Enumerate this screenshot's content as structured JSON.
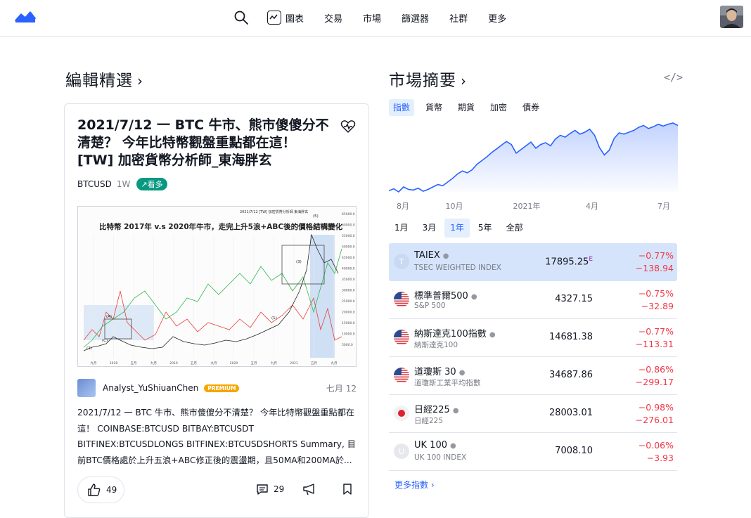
{
  "header": {
    "nav": [
      {
        "label": "圖表",
        "icon": "chart-icon"
      },
      {
        "label": "交易"
      },
      {
        "label": "市場"
      },
      {
        "label": "篩選器"
      },
      {
        "label": "社群"
      },
      {
        "label": "更多"
      }
    ]
  },
  "editors_pick": {
    "title": "編輯精選",
    "chevron": "›",
    "card": {
      "title": "2021/7/12 一 BTC 牛市、熊市傻傻分不清楚？ 今年比特幣觀盤重點都在這！ [TW] 加密貨幣分析師_東海胖玄",
      "symbol": "BTCUSD",
      "interval": "1W",
      "badge": "↗看多",
      "thumbnail": {
        "header": "2021/7/12 [TW] 加密貨幣分析師 東海胖玄",
        "title": "比特幣 2017年 v.s 2020年牛市，走完上升5浪+ABC後的價格結構變化",
        "x_labels": [
          "九月",
          "2018",
          "五月",
          "九月",
          "2019",
          "五月",
          "九月",
          "2020",
          "五月",
          "九月",
          "2021",
          "五月",
          "九月"
        ],
        "y_labels": [
          "65000.0",
          "60000.0",
          "55000.0",
          "50000.0",
          "45000.0",
          "40000.0",
          "35000.0",
          "30000.0",
          "25000.0",
          "20000.0",
          "15000.0",
          "10000.0",
          "5000.0"
        ],
        "annotations": [
          "(2)",
          "(A)",
          "(C)",
          "(1)",
          "(3)",
          "(5)",
          "(B)"
        ]
      },
      "author": "Analyst_YuShiuanChen",
      "premium": "PREMIUM",
      "date": "七月 12",
      "description": "2021/7/12 一 BTC 牛市、熊市傻傻分不清楚？ 今年比特幣觀盤重點都在這！ COINBASE:BTCUSD BITBAY:BTCUSDT BITFINEX:BTCUSDLONGS BITFINEX:BTCUSDSHORTS Summary, 目前BTC價格處於上升五浪+ABC修正後的震盪期，且50MA和200MA於...",
      "likes": "49",
      "comments": "29"
    }
  },
  "market_summary": {
    "title": "市場摘要",
    "chevron": "›",
    "embed": "</>",
    "tabs": [
      "指數",
      "貨幣",
      "期貨",
      "加密",
      "債券"
    ],
    "active_tab": 0,
    "ranges": [
      "1月",
      "3月",
      "1年",
      "5年",
      "全部"
    ],
    "active_range": 2,
    "more_link": "更多指數 ›",
    "chart_data": {
      "type": "area",
      "x_tick_labels": [
        "8月",
        "10月",
        "2021年",
        "4月",
        "7月"
      ],
      "series": [
        {
          "values": [
            12600,
            12750,
            12500,
            12900,
            12700,
            12650,
            12800,
            12550,
            12700,
            12900,
            13100,
            13000,
            13300,
            13600,
            13950,
            14200,
            14050,
            14300,
            14750,
            15050,
            15350,
            15700,
            16000,
            16300,
            16600,
            16350,
            15650,
            15950,
            16250,
            16550,
            16050,
            16350,
            16500,
            16250,
            16800,
            17100,
            16950,
            17250,
            17500,
            17200,
            17350,
            17600,
            17100,
            16100,
            15500,
            15900,
            16850,
            17300,
            17200,
            17350,
            17500,
            17750,
            17900,
            17650,
            17800,
            18000,
            17850,
            18000,
            18100,
            17900
          ]
        }
      ],
      "color": "#2962ff"
    },
    "rows": [
      {
        "name": "TAIEX",
        "sub": "TSEC WEIGHTED INDEX",
        "value": "17895.25",
        "flag_mark": "E",
        "pct": "−0.77%",
        "chg": "−138.94",
        "flag": "tw",
        "flag_letter": "T"
      },
      {
        "name": "標準普爾500",
        "sub": "S&P 500",
        "value": "4327.15",
        "pct": "−0.75%",
        "chg": "−32.89",
        "flag": "us"
      },
      {
        "name": "納斯達克100指數",
        "sub": "納斯達克100",
        "value": "14681.38",
        "pct": "−0.77%",
        "chg": "−113.31",
        "flag": "us"
      },
      {
        "name": "道瓊斯 30",
        "sub": "道瓊斯工業平均指數",
        "value": "34687.86",
        "pct": "−0.86%",
        "chg": "−299.17",
        "flag": "us"
      },
      {
        "name": "日經225",
        "sub": "日經225",
        "value": "28003.01",
        "pct": "−0.98%",
        "chg": "−276.01",
        "flag": "jp"
      },
      {
        "name": "UK 100",
        "sub": "UK 100 INDEX",
        "value": "7008.10",
        "pct": "−0.06%",
        "chg": "−3.93",
        "flag": "uk",
        "flag_letter": "U"
      }
    ]
  }
}
